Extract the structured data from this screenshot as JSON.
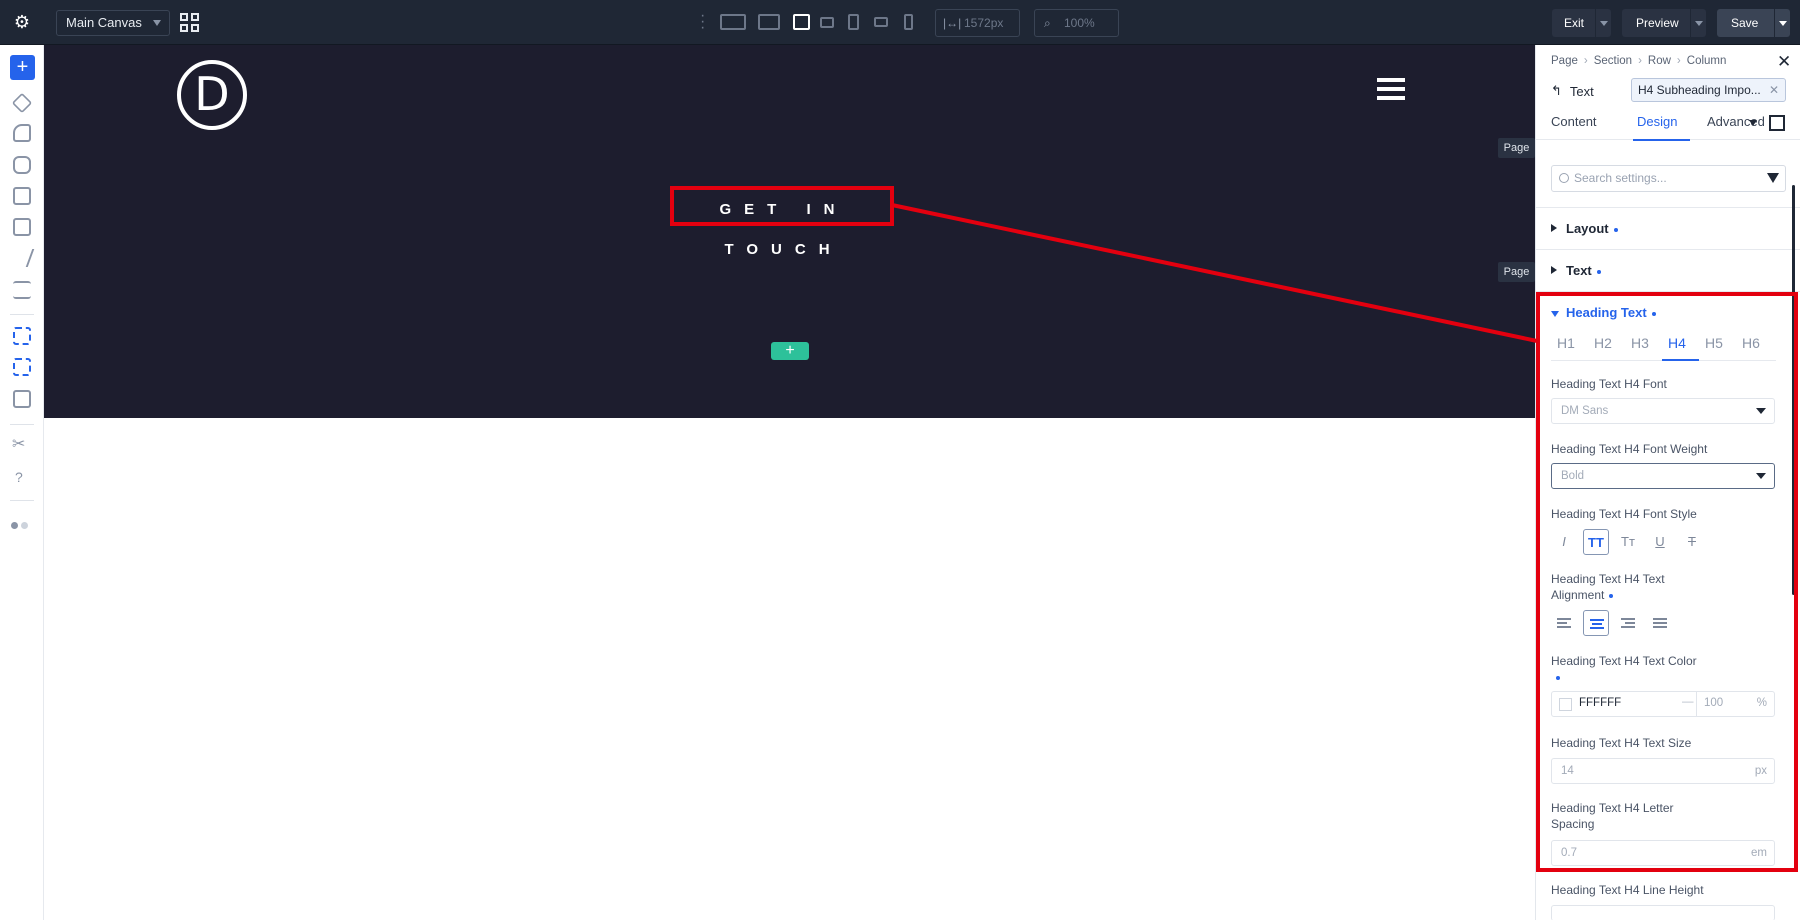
{
  "topbar": {
    "canvas_select": "Main Canvas",
    "width_value": "1572px",
    "zoom_value": "100%",
    "exit_label": "Exit",
    "preview_label": "Preview",
    "save_label": "Save"
  },
  "hero": {
    "logo_letter": "D",
    "title": "GET IN TOUCH",
    "page_tag": "Page",
    "add_symbol": "+"
  },
  "sidebar": {
    "add_symbol": "+",
    "help_symbol": "?"
  },
  "panel": {
    "breadcrumb": [
      "Page",
      "Section",
      "Row",
      "Column"
    ],
    "back_label": "Text",
    "preset": "H4 Subheading Impo...",
    "tabs": [
      "Content",
      "Design",
      "Advanced"
    ],
    "active_tab": "Design",
    "search_placeholder": "Search settings...",
    "groups": [
      "Layout",
      "Text"
    ],
    "open_group": "Heading Text",
    "heading_tabs": [
      "H1",
      "H2",
      "H3",
      "H4",
      "H5",
      "H6"
    ],
    "active_heading_tab": "H4",
    "fields": {
      "font_label": "Heading Text H4 Font",
      "font_value": "DM Sans",
      "weight_label": "Heading Text H4 Font Weight",
      "weight_value": "Bold",
      "style_label": "Heading Text H4 Font Style",
      "style_buttons": [
        "I",
        "TT",
        "Tт",
        "U",
        "T"
      ],
      "align_label_1": "Heading Text H4 Text",
      "align_label_2": "Alignment",
      "color_label": "Heading Text H4 Text Color",
      "color_value": "FFFFFF",
      "color_dash": "—",
      "opacity_value": "100",
      "opacity_unit": "%",
      "size_label": "Heading Text H4 Text Size",
      "size_value": "14",
      "size_unit": "px",
      "spacing_label_1": "Heading Text H4 Letter",
      "spacing_label_2": "Spacing",
      "spacing_value": "0.7",
      "spacing_unit": "em",
      "line_height_label": "Heading Text H4 Line Height"
    }
  },
  "colors": {
    "accent": "#2563eb",
    "topbar": "#1f2735",
    "hero_bg": "#1d1d2e",
    "annotation": "#e3000f",
    "add_row": "#2dc19a"
  }
}
